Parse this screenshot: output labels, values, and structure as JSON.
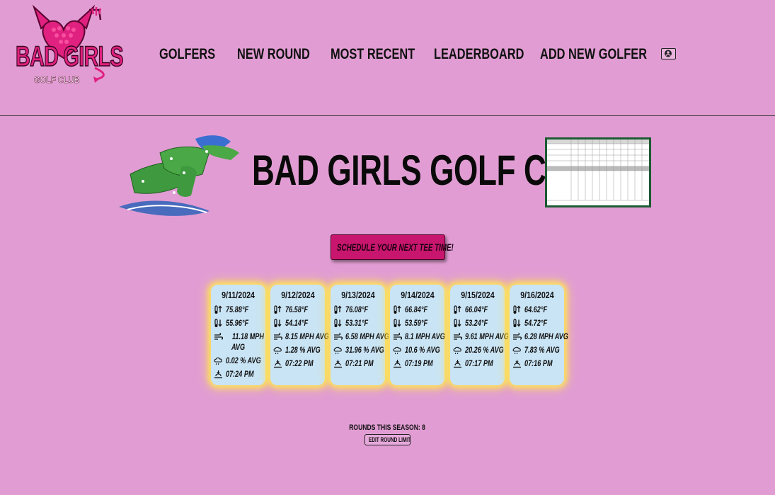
{
  "brand": {
    "logo_line1": "BAD GIRLS",
    "logo_line2": "GOLF CLUB",
    "colors": {
      "background": "#e19dd3",
      "accent": "#c8166e",
      "card": "#c9e4f5",
      "glow": "#ffe650"
    }
  },
  "nav": {
    "items": [
      "GOLFERS",
      "NEW ROUND",
      "MOST RECENT",
      "LEADERBOARD",
      "ADD NEW GOLFER"
    ],
    "user_icon": "user-circle-icon"
  },
  "hero": {
    "title": "BAD GIRLS GOLF CLUB",
    "cta_label": "SCHEDULE YOUR NEXT TEE TIME!"
  },
  "forecast": {
    "days": [
      {
        "date": "9/11/2024",
        "high": "75.88°F",
        "low": "55.96°F",
        "wind": "11.18 MPH AVG",
        "precip": "0.02 % AVG",
        "sunset": "07:24 PM"
      },
      {
        "date": "9/12/2024",
        "high": "76.58°F",
        "low": "54.14°F",
        "wind": "8.15 MPH AVG",
        "precip": "1.28 % AVG",
        "sunset": "07:22 PM"
      },
      {
        "date": "9/13/2024",
        "high": "76.08°F",
        "low": "53.31°F",
        "wind": "6.58 MPH AVG",
        "precip": "31.96 % AVG",
        "sunset": "07:21 PM"
      },
      {
        "date": "9/14/2024",
        "high": "66.84°F",
        "low": "53.59°F",
        "wind": "8.1 MPH AVG",
        "precip": "10.6 % AVG",
        "sunset": "07:19 PM"
      },
      {
        "date": "9/15/2024",
        "high": "66.04°F",
        "low": "53.24°F",
        "wind": "9.61 MPH AVG",
        "precip": "20.26 % AVG",
        "sunset": "07:17 PM"
      },
      {
        "date": "9/16/2024",
        "high": "64.62°F",
        "low": "54.72°F",
        "wind": "6.28 MPH AVG",
        "precip": "7.83 % AVG",
        "sunset": "07:16 PM"
      }
    ],
    "icons": {
      "high": "thermometer-up-icon",
      "low": "thermometer-down-icon",
      "wind": "wind-icon",
      "precip": "cloud-rain-icon",
      "sunset": "sunset-icon"
    }
  },
  "season": {
    "rounds_text": "ROUNDS THIS SEASON: 8",
    "edit_label": "EDIT ROUND LIMIT"
  }
}
